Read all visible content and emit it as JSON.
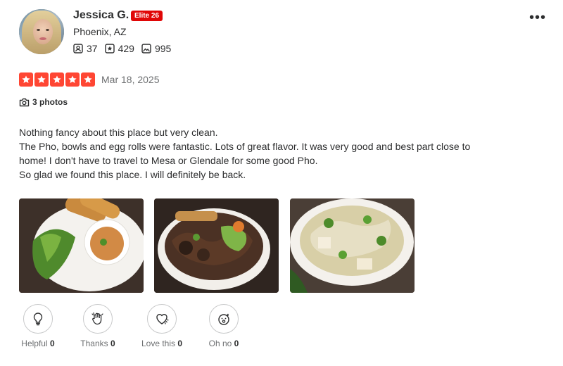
{
  "user": {
    "name": "Jessica G.",
    "elite_badge": "Elite 26",
    "location": "Phoenix, AZ",
    "friends_count": "37",
    "reviews_count": "429",
    "photos_count": "995"
  },
  "review": {
    "rating": 5,
    "rating_max": 5,
    "date": "Mar 18, 2025",
    "photos_label": "3 photos",
    "text_lines": [
      "Nothing fancy about this place but very clean.",
      "The Pho, bowls and egg rolls were fantastic. Lots of great flavor. It was very good and best part close to home! I don't have to travel to Mesa or Glendale for some good Pho.",
      "So glad we found this place. I will definitely be back."
    ]
  },
  "reactions": [
    {
      "label": "Helpful",
      "count": "0",
      "icon": "lightbulb-icon"
    },
    {
      "label": "Thanks",
      "count": "0",
      "icon": "waving-hand-icon"
    },
    {
      "label": "Love this",
      "count": "0",
      "icon": "heart-icon"
    },
    {
      "label": "Oh no",
      "count": "0",
      "icon": "surprised-face-icon"
    }
  ],
  "colors": {
    "star": "#ff4633",
    "elite": "#e00707",
    "text": "#2d2e2f",
    "muted": "#6e7072"
  }
}
